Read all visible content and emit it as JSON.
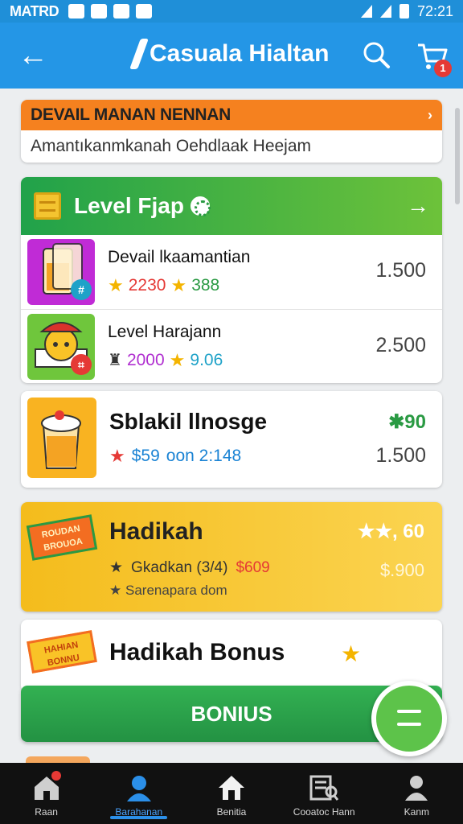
{
  "status": {
    "carrier": "MATRD",
    "time": "72:21"
  },
  "header": {
    "title": "Casuala Hialtan",
    "cart_count": "1"
  },
  "banner": {
    "title": "DEVAIL MANAN NENNAN",
    "subtitle": "Amantıkanmkanah Oehdlaak Heejam"
  },
  "level_card": {
    "title": "Level Fjap",
    "items": [
      {
        "name": "Devail lkaamantian",
        "stat1": "2230",
        "stat2": "388",
        "price": "1.500",
        "badge": "#"
      },
      {
        "name": "Level Harajann",
        "stat1": "2000",
        "stat2": "9.06",
        "price": "2.500",
        "badge": "⌗"
      }
    ]
  },
  "product": {
    "name": "Sblakil llnosge",
    "stat_value": "$59",
    "stat_text": "oon 2:148",
    "tag": "✱90",
    "price": "1.500"
  },
  "gift": {
    "ribbon": "ROUDAN BROUOA",
    "title": "Hadikah",
    "rating": "★★, 60",
    "line1_label": "Gkadkan (3/4)",
    "line1_price": "$609",
    "line2": "Sarenapara dom",
    "price": "$.900"
  },
  "bonus": {
    "ribbon": "HAHIAN BONNU",
    "title": "Hadikah Bonus",
    "button": "BONIUS"
  },
  "nav": [
    {
      "label": "Raan"
    },
    {
      "label": "Barahanan"
    },
    {
      "label": "Benitia"
    },
    {
      "label": "Cooatoc Hann"
    },
    {
      "label": "Kanm"
    }
  ]
}
